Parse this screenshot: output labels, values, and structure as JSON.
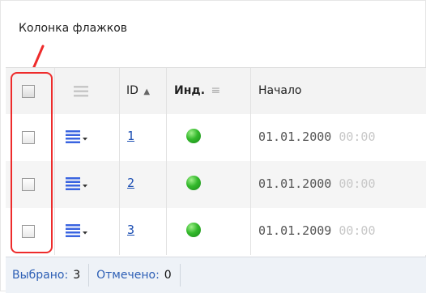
{
  "annotation": {
    "title": "Колонка флажков"
  },
  "grid": {
    "columns": {
      "id": "ID",
      "sort_indicator": "▲",
      "ind": "Инд.",
      "ind_menu": "≡",
      "start": "Начало"
    },
    "rows": [
      {
        "id": "1",
        "date_main": "01.01.2000",
        "date_faded": " 00:00",
        "status_color": "#2fb52a"
      },
      {
        "id": "2",
        "date_main": "01.01.2000",
        "date_faded": " 00:00",
        "status_color": "#2fb52a"
      },
      {
        "id": "3",
        "date_main": "01.01.2009",
        "date_faded": " 00:00",
        "status_color": "#2fb52a"
      }
    ]
  },
  "footer": {
    "selected_label": "Выбрано:",
    "selected_count": "3",
    "checked_label": "Отмечено:",
    "checked_count": "0"
  },
  "colors": {
    "highlight": "#ee2b2b",
    "link": "#1d4fb3",
    "icon_blue": "#3a64e0"
  }
}
